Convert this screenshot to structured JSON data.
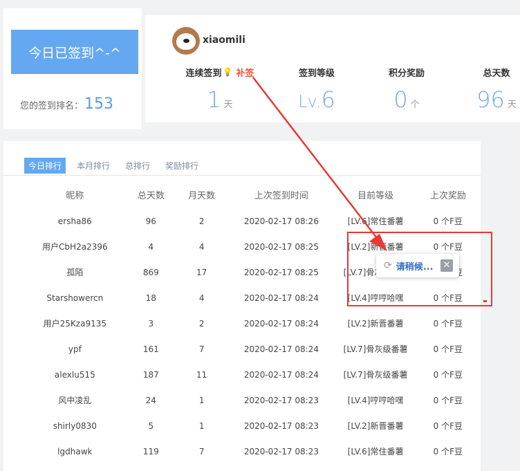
{
  "signin": {
    "button_label": "今日已签到^-^",
    "rank_label": "您的签到排名：",
    "rank_value": "153"
  },
  "user": {
    "avatar_icon": "dog-avatar-icon",
    "name": "xiaomili"
  },
  "stats": [
    {
      "label": "连续签到",
      "value": "1",
      "unit": "天",
      "extra": "补签",
      "extra_icon": "bulb-icon"
    },
    {
      "label": "签到等级",
      "value": "6",
      "prefix": "Lv.",
      "unit": ""
    },
    {
      "label": "积分奖励",
      "value": "0",
      "unit": "个"
    },
    {
      "label": "总天数",
      "value": "96",
      "unit": "天"
    }
  ],
  "tabs": [
    "今日排行",
    "本月排行",
    "总排行",
    "奖励排行"
  ],
  "active_tab": 0,
  "table": {
    "headers": [
      "昵称",
      "总天数",
      "月天数",
      "上次签到时间",
      "目前等级",
      "上次奖励"
    ],
    "rows": [
      [
        "ersha86",
        "96",
        "2",
        "2020-02-17 08:26",
        "[LV.6]常住番薯",
        "0 个F豆"
      ],
      [
        "用户CbH2a2396",
        "4",
        "4",
        "2020-02-17 08:25",
        "[LV.2]新晋番薯",
        "0 个F豆"
      ],
      [
        "孤陌",
        "869",
        "17",
        "2020-02-17 08:25",
        "[LV.7]骨灰级番薯",
        "0 个F豆"
      ],
      [
        "Starshowercn",
        "18",
        "4",
        "2020-02-17 08:24",
        "[LV.4]哼哼哈嘿",
        "0 个F豆"
      ],
      [
        "用户25Kza9135",
        "3",
        "2",
        "2020-02-17 08:24",
        "[LV.2]新晋番薯",
        "0 个F豆"
      ],
      [
        "ypf",
        "161",
        "7",
        "2020-02-17 08:24",
        "[LV.7]骨灰级番薯",
        "0 个F豆"
      ],
      [
        "alexlu515",
        "187",
        "11",
        "2020-02-17 08:24",
        "[LV.7]骨灰级番薯",
        "0 个F豆"
      ],
      [
        "风中凌乱",
        "24",
        "1",
        "2020-02-17 08:23",
        "[LV.4]哼哼哈嘿",
        "0 个F豆"
      ],
      [
        "shirly0830",
        "5",
        "1",
        "2020-02-17 08:23",
        "[LV.2]新晋番薯",
        "0 个F豆"
      ],
      [
        "lgdhawk",
        "119",
        "7",
        "2020-02-17 08:23",
        "[LV.6]常住番薯",
        "0 个F豆"
      ]
    ]
  },
  "loading": {
    "text": "请稍候...",
    "spinner_icon": "refresh-icon",
    "close_icon": "close-icon",
    "close_glyph": "✕"
  },
  "colors": {
    "accent": "#64a8f1",
    "stat_number": "#72a7e6",
    "buqian": "#e55d3d",
    "annotation": "#e53935"
  }
}
